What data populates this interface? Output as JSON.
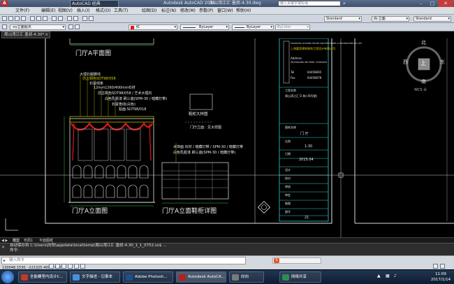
{
  "window": {
    "title_left": "AutoCAD 经典",
    "app_title": "Autodesk AutoCAD 2014",
    "document_title": "周山湾江汇 墨叔-4.30.dwg",
    "search_placeholder": "键入关键字或短语",
    "controls": [
      "–",
      "□",
      "✕"
    ]
  },
  "menu": {
    "items": [
      "文件(F)",
      "编辑(E)",
      "视图(V)",
      "插入(I)",
      "格式(O)",
      "工具(T)",
      "绘图(D)",
      "标注(N)",
      "修改(M)",
      "参数(P)",
      "窗口(W)",
      "帮助(H)"
    ]
  },
  "toolbar": {
    "ucs_combo": "-xy立面图法",
    "layer_color": "红",
    "linetype": "ByLayer",
    "lineweight": "ByLayer",
    "plotstyle": "ByColor",
    "text_style": "Standard",
    "dim_style": "尚-立面",
    "table_style": "Standard"
  },
  "document_tab": {
    "label": "周山湾江汇 墨叔-4.30*",
    "close": "×"
  },
  "drawing": {
    "plan_title": "门厅A平面图",
    "elev_title": "门厅A立面图",
    "cabinet_title": "门厅A立面鞋柜详图",
    "detail_title": "鞋柜大样图",
    "annotations": [
      "大理石踢脚线",
      "仿古铜色SDT98/058",
      "石膏线条",
      "12mm1260/400mm石材",
      "仿古铜色SDT98/058 / 艺术大理石",
      "白色乳胶漆 刷三遍(SPM-30 / 暗藏灯带)",
      "石膏角线(白色)",
      "贴面-SDT98/018",
      "木饰面 石材 / 暗藏灯带 / SPM-30 / 暗藏灯带",
      "门厅立面：见大样图",
      "白色乳胶漆 刷三遍(SPM-30 / 暗藏灯带)"
    ]
  },
  "title_block": {
    "company": "SHANGHAI GOLDEN HOUSE ARCHITECTURE & DECORATION CO.,LTD",
    "company_cn": "上海嘉里建筑装饰工程设计有限公司",
    "address_label": "Address",
    "address": "ZHANGJIANG IND PARK, SHANGHAI",
    "tel_label": "Tel",
    "tel": "64458665",
    "fax_label": "Fax",
    "fax": "64458678",
    "project_label": "工程名称",
    "project": "周山湾江汇 D 栋( 四号楼)",
    "drawing_label": "图纸名称",
    "drawing_name": "门  厅",
    "scale_label": "比例",
    "scale": "1:30",
    "date_label": "日期",
    "date": "2015.04",
    "no_label": "图号",
    "no": "21",
    "rows": [
      "设计",
      "校对",
      "审核",
      "审定",
      "制图"
    ]
  },
  "compass": {
    "north": "北",
    "south": "南",
    "east": "东",
    "west": "西",
    "center": "上",
    "wcs": "WCS ☰"
  },
  "layout_tabs": [
    "模型",
    "布局1",
    "平面图纸"
  ],
  "command_line": {
    "line1": "自动保存到 C:\\Users\\向阳\\appdata\\local\\temp\\周山湾江汇 墨叔-4.30_1_1_0752.sv$ ...",
    "line2": "命令:",
    "prompt": "键入命令"
  },
  "status": {
    "coordinates": "130048.1530, -221325.4093, 0.0000"
  },
  "taskbar": {
    "items": [
      {
        "label": "全能螺室内设计C...",
        "color": "#c0392b"
      },
      {
        "label": "文字描述 - 记事本",
        "color": "#4a90d9"
      },
      {
        "label": "Adobe Photosh...",
        "color": "#1f4e8c"
      },
      {
        "label": "Autodesk AutoCA...",
        "color": "#b22222"
      },
      {
        "label": "向向",
        "color": "#7a7a7a"
      },
      {
        "label": "网络共享",
        "color": "#2e8b57"
      }
    ],
    "time": "11:09",
    "date": "2017/1/14"
  }
}
